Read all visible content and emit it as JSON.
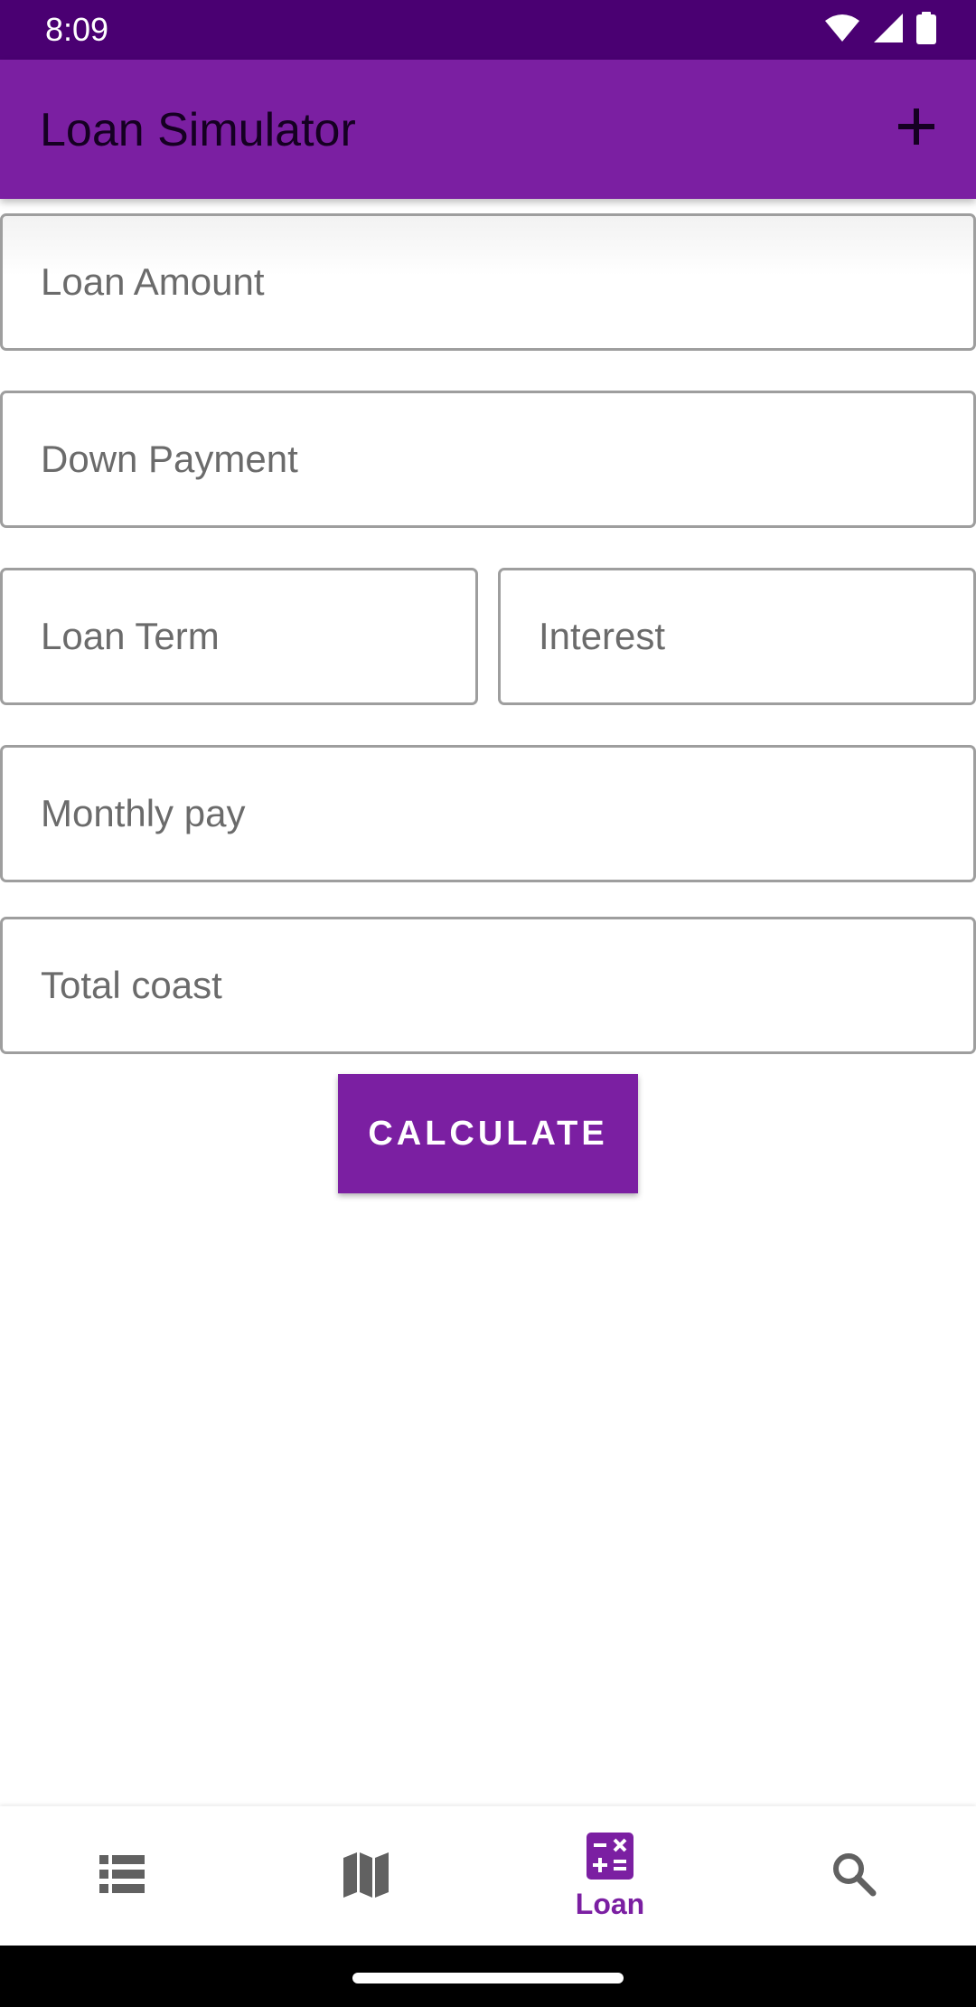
{
  "status_bar": {
    "time": "8:09",
    "icons": [
      "wifi-icon",
      "signal-icon",
      "battery-icon"
    ]
  },
  "app_bar": {
    "title": "Loan Simulator",
    "action_icon": "add-icon"
  },
  "form": {
    "loan_amount": {
      "placeholder": "Loan Amount",
      "value": ""
    },
    "down_payment": {
      "placeholder": "Down Payment",
      "value": ""
    },
    "loan_term": {
      "placeholder": "Loan Term",
      "value": ""
    },
    "interest": {
      "placeholder": "Interest",
      "value": ""
    },
    "monthly_pay": {
      "placeholder": "Monthly pay",
      "value": ""
    },
    "total_cost": {
      "placeholder": "Total coast",
      "value": ""
    },
    "calculate_label": "CALCULATE"
  },
  "bottom_nav": {
    "items": [
      {
        "icon": "list-icon",
        "label": "",
        "selected": false
      },
      {
        "icon": "map-icon",
        "label": "",
        "selected": false
      },
      {
        "icon": "calculator-icon",
        "label": "Loan",
        "selected": true
      },
      {
        "icon": "search-icon",
        "label": "",
        "selected": false
      }
    ]
  },
  "colors": {
    "status_bar": "#4a0072",
    "primary": "#7b1fa2",
    "field_border": "#9e9e9e",
    "icon_inactive": "#616161"
  }
}
